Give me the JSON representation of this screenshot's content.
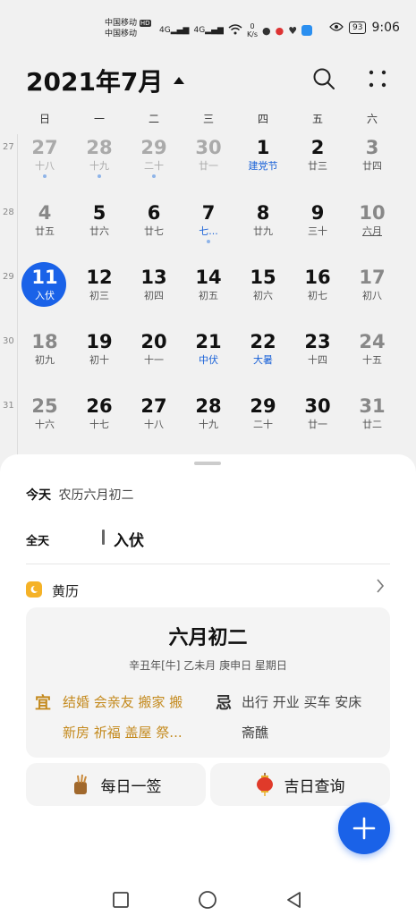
{
  "status_bar": {
    "carrier1": "中国移动",
    "carrier2": "中国移动",
    "hd": "HD",
    "net1": "4G",
    "net2": "4G",
    "speed": "0",
    "speed_unit": "K/s",
    "battery": "93",
    "time": "9:06"
  },
  "header": {
    "title": "2021年7月"
  },
  "weekdays": [
    "日",
    "一",
    "二",
    "三",
    "四",
    "五",
    "六"
  ],
  "weeks": [
    {
      "num": "27",
      "days": [
        {
          "n": "27",
          "s": "十八",
          "other": true,
          "dot": true
        },
        {
          "n": "28",
          "s": "十九",
          "other": true,
          "dot": true
        },
        {
          "n": "29",
          "s": "二十",
          "other": true,
          "dot": true
        },
        {
          "n": "30",
          "s": "廿一",
          "other": true
        },
        {
          "n": "1",
          "s": "建党节",
          "holiday": true
        },
        {
          "n": "2",
          "s": "廿三"
        },
        {
          "n": "3",
          "s": "廿四",
          "weekend": true
        }
      ]
    },
    {
      "num": "28",
      "days": [
        {
          "n": "4",
          "s": "廿五",
          "weekend": true
        },
        {
          "n": "5",
          "s": "廿六"
        },
        {
          "n": "6",
          "s": "廿七"
        },
        {
          "n": "7",
          "s": "七...",
          "holiday": true,
          "dot": true
        },
        {
          "n": "8",
          "s": "廿九"
        },
        {
          "n": "9",
          "s": "三十"
        },
        {
          "n": "10",
          "s": "六月",
          "weekend": true,
          "underline": true
        }
      ]
    },
    {
      "num": "29",
      "days": [
        {
          "n": "11",
          "s": "入伏",
          "today": true
        },
        {
          "n": "12",
          "s": "初三"
        },
        {
          "n": "13",
          "s": "初四"
        },
        {
          "n": "14",
          "s": "初五"
        },
        {
          "n": "15",
          "s": "初六"
        },
        {
          "n": "16",
          "s": "初七"
        },
        {
          "n": "17",
          "s": "初八",
          "weekend": true
        }
      ]
    },
    {
      "num": "30",
      "days": [
        {
          "n": "18",
          "s": "初九",
          "weekend": true
        },
        {
          "n": "19",
          "s": "初十"
        },
        {
          "n": "20",
          "s": "十一"
        },
        {
          "n": "21",
          "s": "中伏",
          "holiday": true
        },
        {
          "n": "22",
          "s": "大暑",
          "holiday": true
        },
        {
          "n": "23",
          "s": "十四"
        },
        {
          "n": "24",
          "s": "十五",
          "weekend": true
        }
      ]
    },
    {
      "num": "31",
      "days": [
        {
          "n": "25",
          "s": "十六",
          "weekend": true
        },
        {
          "n": "26",
          "s": "十七"
        },
        {
          "n": "27",
          "s": "十八"
        },
        {
          "n": "28",
          "s": "十九"
        },
        {
          "n": "29",
          "s": "二十"
        },
        {
          "n": "30",
          "s": "廿一"
        },
        {
          "n": "31",
          "s": "廿二",
          "weekend": true
        }
      ]
    }
  ],
  "sheet": {
    "today_label": "今天",
    "lunar_date": "农历六月初二",
    "allday_label": "全天",
    "event_title": "入伏",
    "almanac_title": "黄历",
    "card": {
      "title": "六月初二",
      "date_line": "辛丑年[牛]  乙未月 庚申日 星期日",
      "yi_char": "宜",
      "yi_line1": "结婚 会亲友 搬家 搬",
      "yi_line2": "新房 祈福 盖屋 祭...",
      "ji_char": "忌",
      "ji_line1": "出行 开业 买车 安床",
      "ji_line2": "斋醮"
    },
    "btn_sign": "每日一签",
    "btn_lucky": "吉日查询"
  },
  "colors": {
    "accent": "#1a62e8",
    "almanac": "#c48a1e",
    "holiday": "#1a62d8"
  }
}
